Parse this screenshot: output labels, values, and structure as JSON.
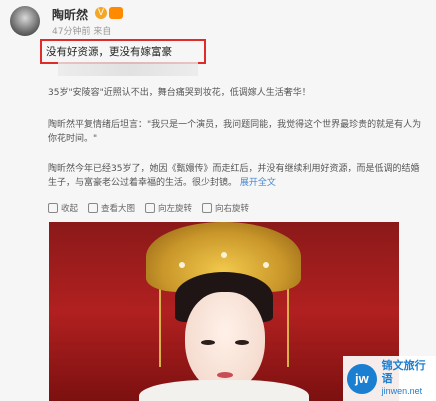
{
  "post": {
    "username": "陶昕然",
    "time": "47分钟前 来自",
    "headline": "没有好资源，更没有嫁富豪",
    "paragraph1": "35岁\"安陵容\"近照认不出，舞台痛哭到妆花，低调嫁人生活奢华！",
    "paragraph2": "陶昕然平复情绪后坦言：\"我只是一个演员，我问题同能，我觉得这个世界最珍贵的就是有人为你花时间。\"",
    "paragraph3": "陶昕然今年已经35岁了，她因《甄嬛传》而走红后，并没有继续利用好资源，而是低调的结婚生子，与富豪老公过着幸福的生活。很少封镜。",
    "more_link": "展开全文",
    "actions": [
      "收起",
      "查看大图",
      "向左旋转",
      "向右旋转"
    ]
  },
  "watermark": {
    "logo": "jw",
    "name": "锦文旅行语",
    "url": "jinwen.net"
  },
  "colors": {
    "highlight_border": "#e02b2b",
    "link": "#4a88d0"
  }
}
